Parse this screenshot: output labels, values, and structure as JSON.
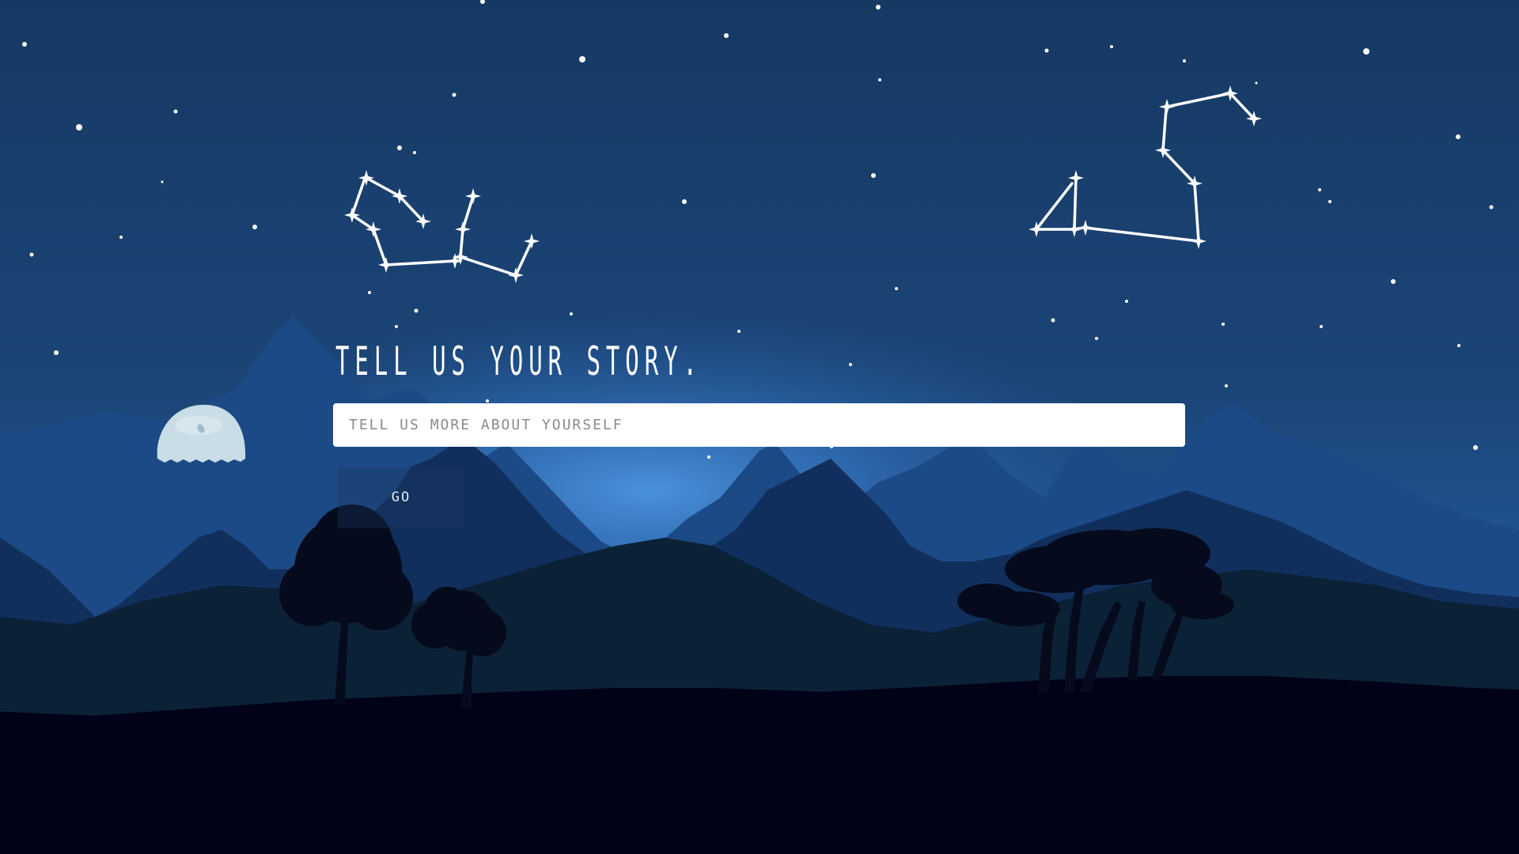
{
  "hero": {
    "title": "TELL US YOUR STORY."
  },
  "form": {
    "input_placeholder": "TELL US MORE ABOUT YOURSELF",
    "input_value": "",
    "submit_label": "GO"
  },
  "colors": {
    "sky_top": "#173b68",
    "sky_glow": "#3f86d4",
    "mountains_far": "#1a4a8a",
    "mountains_mid": "#102f5a",
    "hills_near": "#0b2238",
    "ground": "#010118",
    "stars": "#ffffff"
  }
}
